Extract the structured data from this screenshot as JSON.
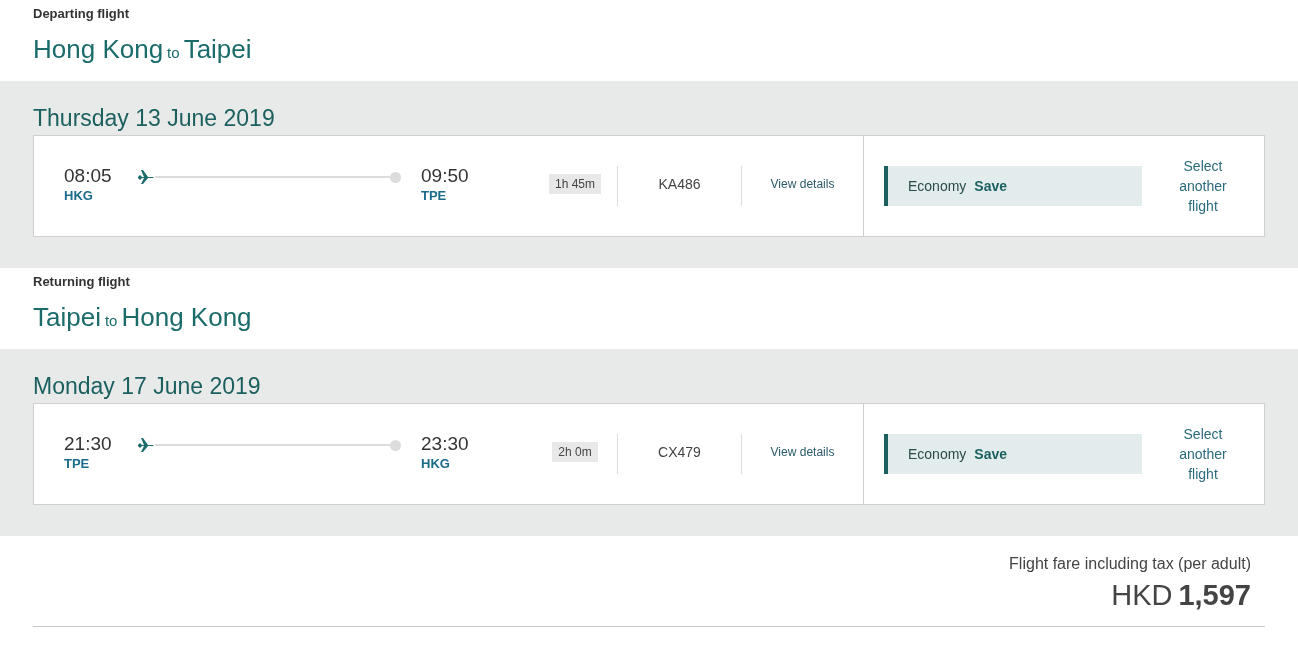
{
  "journeys": [
    {
      "heading": "Departing flight",
      "from": "Hong Kong",
      "connector": "to",
      "to": "Taipei",
      "date": "Thursday 13 June 2019",
      "flight": {
        "depart_time": "08:05",
        "depart_code": "HKG",
        "arrive_time": "09:50",
        "arrive_code": "TPE",
        "duration": "1h 45m",
        "number": "KA486",
        "details_link": "View details",
        "cabin": "Economy",
        "fare": "Save",
        "change_link": "Select another flight"
      }
    },
    {
      "heading": "Returning flight",
      "from": "Taipei",
      "connector": "to",
      "to": "Hong Kong",
      "date": "Monday 17 June 2019",
      "flight": {
        "depart_time": "21:30",
        "depart_code": "TPE",
        "arrive_time": "23:30",
        "arrive_code": "HKG",
        "duration": "2h 0m",
        "number": "CX479",
        "details_link": "View details",
        "cabin": "Economy",
        "fare": "Save",
        "change_link": "Select another flight"
      }
    }
  ],
  "total": {
    "label": "Flight fare including tax (per adult)",
    "currency": "HKD",
    "amount": "1,597"
  }
}
